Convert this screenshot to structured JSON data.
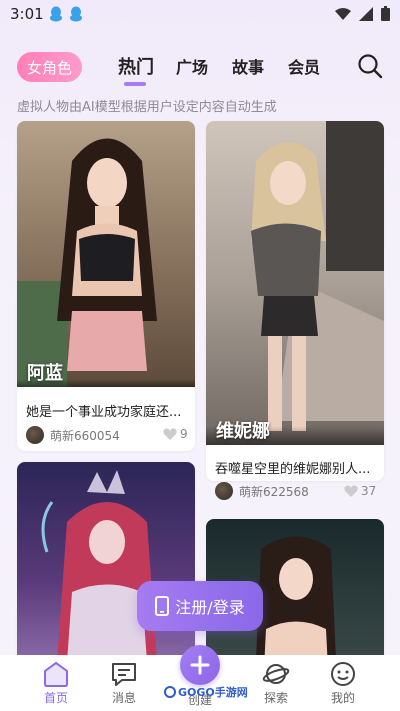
{
  "status_bar": {
    "time": "3:01"
  },
  "header": {
    "role_pill": "女角色",
    "tabs": [
      {
        "label": "热门",
        "active": true
      },
      {
        "label": "广场",
        "active": false
      },
      {
        "label": "故事",
        "active": false
      },
      {
        "label": "会员",
        "active": false
      }
    ],
    "subtitle": "虚拟人物由AI模型根据用户设定内容自动生成"
  },
  "cards": [
    {
      "name": "阿蓝",
      "description": "她是一个事业成功家庭还...",
      "author": "萌新660054",
      "likes": "9"
    },
    {
      "name": "维妮娜",
      "description": "吞噬星空里的维妮娜别人...",
      "author": "萌新622568",
      "likes": "37"
    },
    {
      "name": "",
      "description": "",
      "author": "",
      "likes": ""
    },
    {
      "name": "",
      "description": "",
      "author": "",
      "likes": ""
    }
  ],
  "register_button": {
    "label": "注册/登录"
  },
  "bottom_nav": {
    "items": [
      {
        "label": "首页",
        "icon": "home-icon",
        "active": true
      },
      {
        "label": "消息",
        "icon": "message-icon",
        "active": false
      },
      {
        "label": "创建",
        "icon": "plus-icon",
        "active": false
      },
      {
        "label": "探索",
        "icon": "planet-icon",
        "active": false
      },
      {
        "label": "我的",
        "icon": "smiley-icon",
        "active": false
      }
    ]
  },
  "watermark": "GOGO手游网",
  "colors": {
    "accent": "#8a68e8",
    "pill": "#ff8dc1",
    "background": "#f3eefa"
  }
}
